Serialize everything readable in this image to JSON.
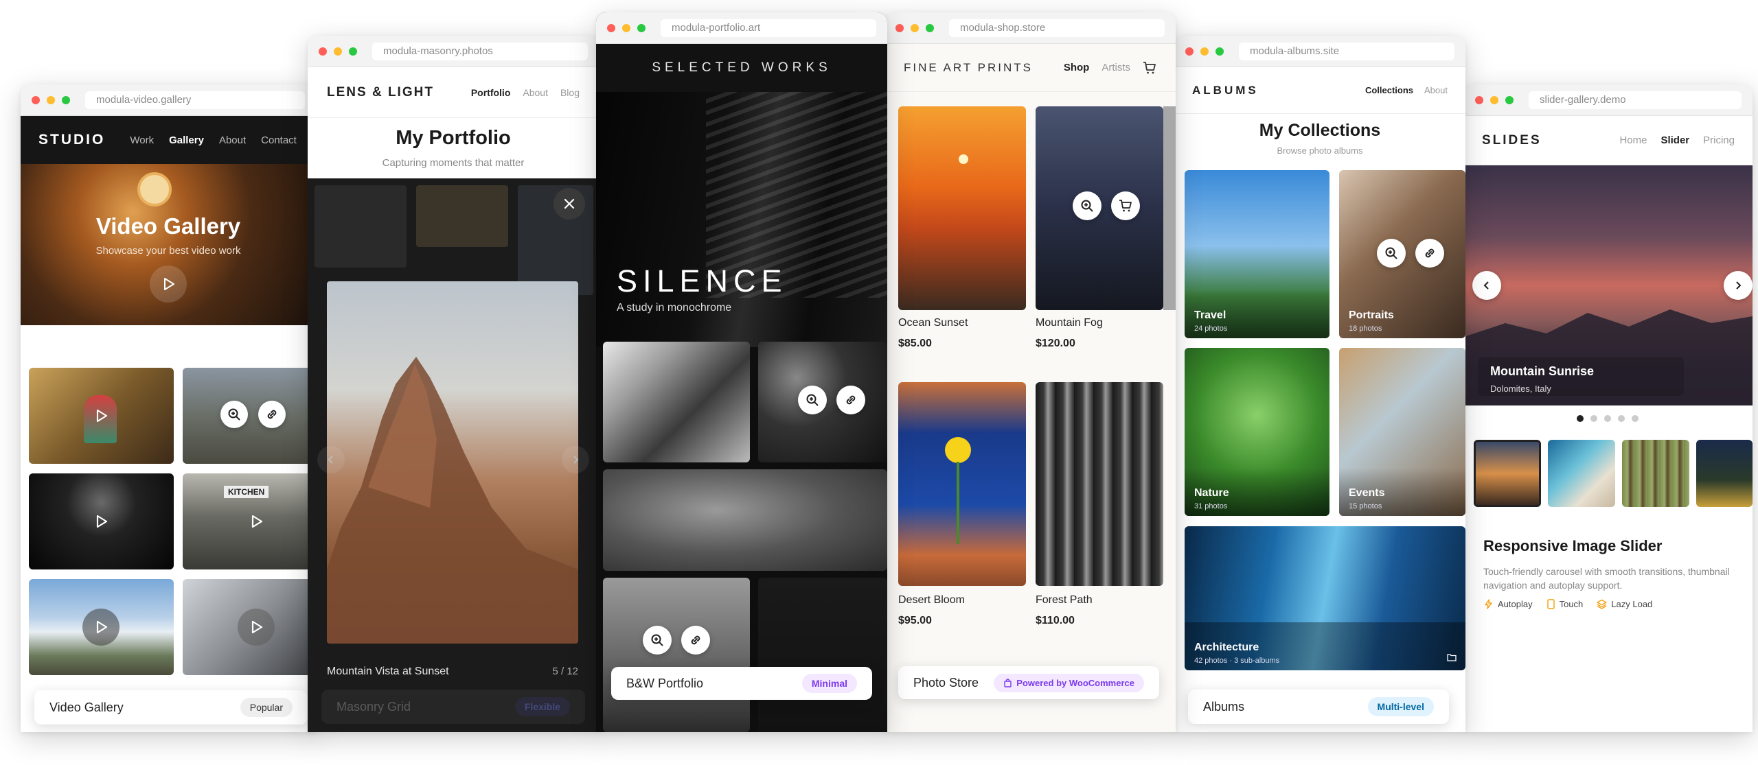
{
  "w1": {
    "url": "modula-video.gallery",
    "brand": "STUDIO",
    "nav": [
      "Work",
      "Gallery",
      "About",
      "Contact"
    ],
    "hero_title": "Video Gallery",
    "hero_subtitle": "Showcase your best video work",
    "card_title": "Video Gallery",
    "card_badge": "Popular"
  },
  "w2": {
    "url": "modula-masonry.photos",
    "brand": "LENS & LIGHT",
    "nav": [
      "Portfolio",
      "About",
      "Blog"
    ],
    "title": "My Portfolio",
    "subtitle": "Capturing moments that matter",
    "lightbox_caption": "Mountain Vista at Sunset",
    "lightbox_counter": "5 / 12",
    "card_title": "Masonry Grid",
    "card_badge": "Flexible"
  },
  "w3": {
    "url": "modula-portfolio.art",
    "header": "SELECTED WORKS",
    "hero_title": "SILENCE",
    "hero_subtitle": "A study in monochrome",
    "card_title": "B&W Portfolio",
    "card_badge": "Minimal"
  },
  "w4": {
    "url": "modula-shop.store",
    "brand": "FINE ART PRINTS",
    "nav": [
      "Shop",
      "Artists"
    ],
    "products": [
      {
        "name": "Ocean Sunset",
        "price": "$85.00"
      },
      {
        "name": "Mountain Fog",
        "price": "$120.00"
      },
      {
        "name": "Desert Bloom",
        "price": "$95.00"
      },
      {
        "name": "Forest Path",
        "price": "$110.00"
      }
    ],
    "card_title": "Photo Store",
    "card_badge": "Powered by WooCommerce"
  },
  "w5": {
    "url": "modula-albums.site",
    "brand": "ALBUMS",
    "nav": [
      "Collections",
      "About"
    ],
    "title": "My Collections",
    "subtitle": "Browse photo albums",
    "albums": [
      {
        "name": "Travel",
        "count": "24 photos"
      },
      {
        "name": "Portraits",
        "count": "18 photos"
      },
      {
        "name": "Nature",
        "count": "31 photos"
      },
      {
        "name": "Events",
        "count": "15 photos"
      },
      {
        "name": "Architecture",
        "count": "42 photos · 3 sub-albums"
      }
    ],
    "card_title": "Albums",
    "card_badge": "Multi-level"
  },
  "w6": {
    "url": "slider-gallery.demo",
    "brand": "SLIDES",
    "nav": [
      "Home",
      "Slider",
      "Pricing"
    ],
    "slide_title": "Mountain Sunrise",
    "slide_subtitle": "Dolomites, Italy",
    "heading": "Responsive Image Slider",
    "description": "Touch-friendly carousel with smooth transitions, thumbnail navigation and autoplay support.",
    "features": [
      "Autoplay",
      "Touch",
      "Lazy Load"
    ]
  },
  "colors": {
    "purple_accent": "#7c3aed",
    "blue_accent": "#0369a1",
    "feature_icon": "#f59e0b"
  }
}
